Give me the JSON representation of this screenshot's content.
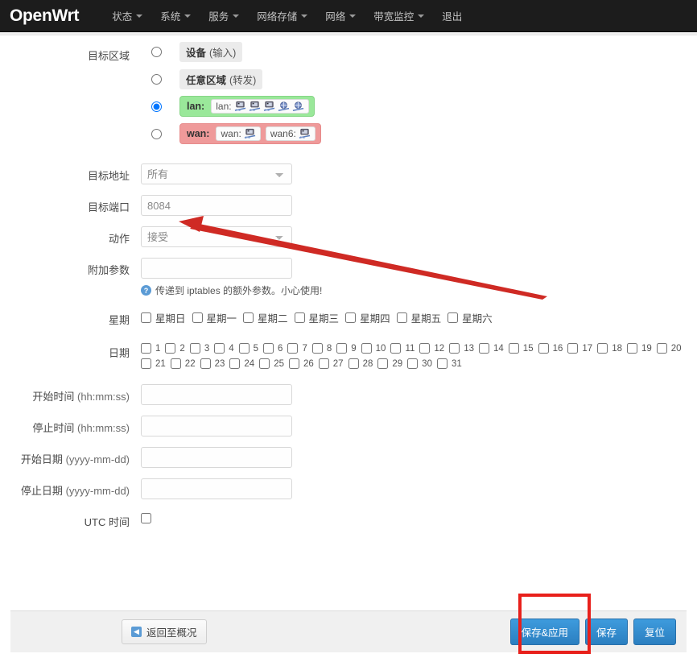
{
  "navbar": {
    "brand": "OpenWrt",
    "items": [
      {
        "label": "状态",
        "has_caret": true
      },
      {
        "label": "系统",
        "has_caret": true
      },
      {
        "label": "服务",
        "has_caret": true
      },
      {
        "label": "网络存储",
        "has_caret": true
      },
      {
        "label": "网络",
        "has_caret": true
      },
      {
        "label": "带宽监控",
        "has_caret": true
      },
      {
        "label": "退出",
        "has_caret": false
      }
    ]
  },
  "form": {
    "dest_zone": {
      "label": "目标区域",
      "options": [
        {
          "type": "plain",
          "name": "设备",
          "paren": "(输入)",
          "selected": false
        },
        {
          "type": "plain",
          "name": "任意区域",
          "paren": "(转发)",
          "selected": false
        },
        {
          "type": "zone",
          "name": "lan:",
          "style": "lan",
          "selected": true,
          "pills": [
            {
              "text": "lan:",
              "icons": [
                "ethernet-icon",
                "ethernet-icon",
                "ethernet-icon",
                "wireless-icon",
                "wireless-icon"
              ]
            }
          ]
        },
        {
          "type": "zone",
          "name": "wan:",
          "style": "wan",
          "selected": false,
          "pills": [
            {
              "text": "wan:",
              "icons": [
                "ethernet-icon"
              ]
            },
            {
              "text": "wan6:",
              "icons": [
                "ethernet-icon"
              ]
            }
          ]
        }
      ]
    },
    "dest_address": {
      "label": "目标地址",
      "value": "所有"
    },
    "dest_port": {
      "label": "目标端口",
      "value": "8084"
    },
    "action": {
      "label": "动作",
      "value": "接受"
    },
    "extra_args": {
      "label": "附加参数",
      "value": "",
      "help": "传递到 iptables 的额外参数。小心使用!"
    },
    "weekdays": {
      "label": "星期",
      "items": [
        "星期日",
        "星期一",
        "星期二",
        "星期三",
        "星期四",
        "星期五",
        "星期六"
      ]
    },
    "monthdays": {
      "label": "日期",
      "items": [
        "1",
        "2",
        "3",
        "4",
        "5",
        "6",
        "7",
        "8",
        "9",
        "10",
        "11",
        "12",
        "13",
        "14",
        "15",
        "16",
        "17",
        "18",
        "19",
        "20",
        "21",
        "22",
        "23",
        "24",
        "25",
        "26",
        "27",
        "28",
        "29",
        "30",
        "31"
      ]
    },
    "start_time": {
      "label": "开始时间",
      "hint": "(hh:mm:ss)",
      "value": ""
    },
    "stop_time": {
      "label": "停止时间",
      "hint": "(hh:mm:ss)",
      "value": ""
    },
    "start_date": {
      "label": "开始日期",
      "hint": "(yyyy-mm-dd)",
      "value": ""
    },
    "stop_date": {
      "label": "停止日期",
      "hint": "(yyyy-mm-dd)",
      "value": ""
    },
    "utc_time": {
      "label": "UTC 时间",
      "checked": false
    }
  },
  "footer": {
    "back_label": "返回至概况",
    "save_apply_label": "保存&应用",
    "save_label": "保存",
    "reset_label": "复位"
  },
  "annotations": {
    "highlight_color": "#e8201b",
    "arrow_target": "dest-port-input",
    "rect_target": "save-apply-button"
  }
}
